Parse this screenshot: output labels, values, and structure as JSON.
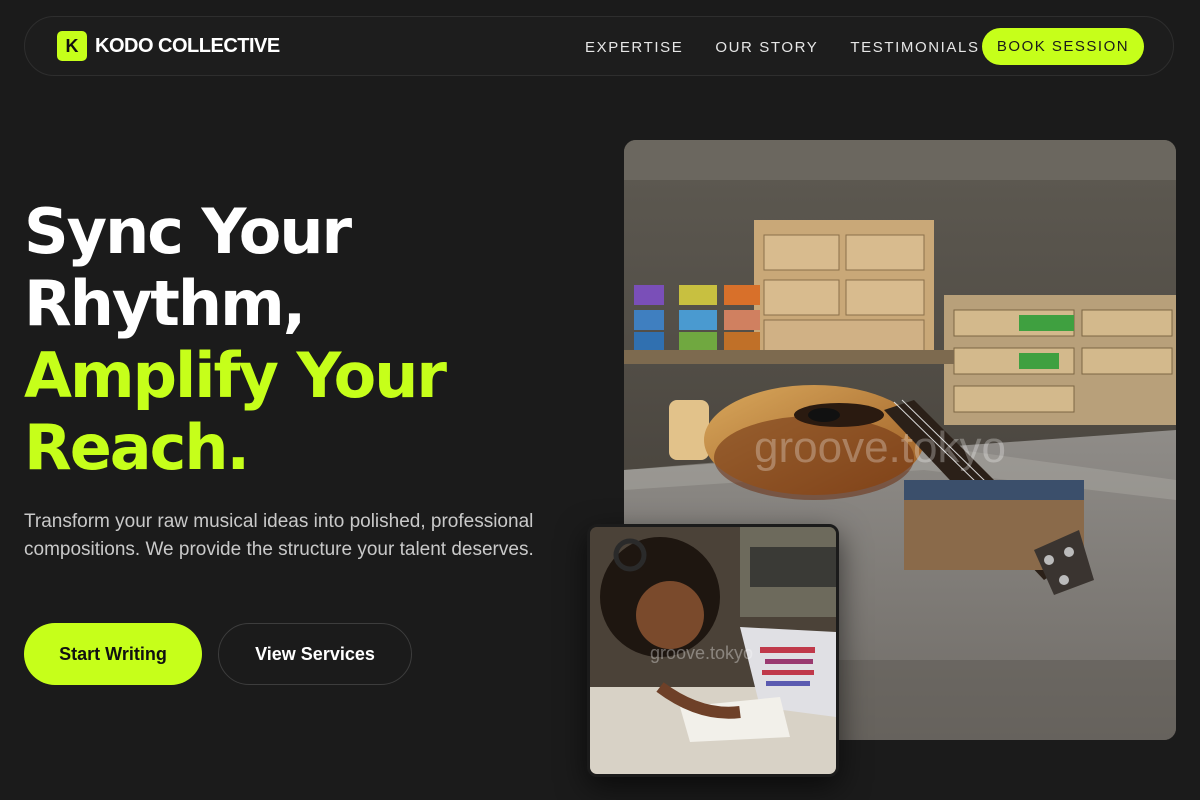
{
  "brand": {
    "logo_letter": "K",
    "name": "KODO COLLECTIVE",
    "accent_color": "#c6ff1a"
  },
  "nav": {
    "links": [
      "EXPERTISE",
      "OUR STORY",
      "TESTIMONIALS"
    ],
    "cta_label": "BOOK SESSION"
  },
  "hero": {
    "title_line1": "Sync Your",
    "title_line2": "Rhythm,",
    "title_line3": "Amplify Your",
    "title_line4": "Reach.",
    "subtitle": "Transform your raw musical ideas into polished, professional compositions. We provide the structure your talent deserves.",
    "primary_button": "Start Writing",
    "secondary_button": "View Services"
  },
  "images": {
    "main_watermark": "groove.tokyo",
    "small_watermark": "groove.tokyo"
  }
}
